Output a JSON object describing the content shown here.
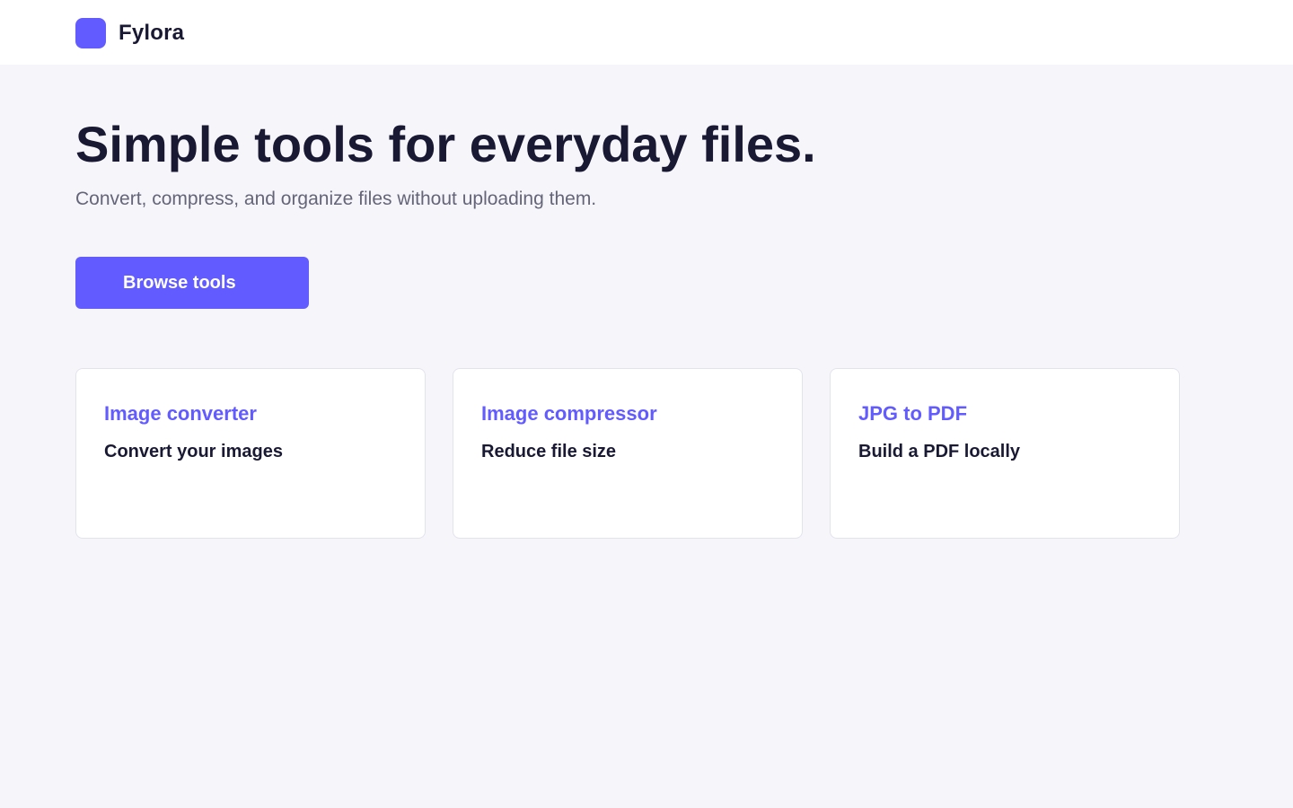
{
  "header": {
    "brand_name": "Fylora"
  },
  "hero": {
    "title": "Simple tools for everyday files.",
    "subtitle": "Convert, compress, and organize files without uploading them.",
    "cta_label": "Browse tools"
  },
  "tools": [
    {
      "title": "Image converter",
      "description": "Convert your images"
    },
    {
      "title": "Image compressor",
      "description": "Reduce file size"
    },
    {
      "title": "JPG to PDF",
      "description": "Build a PDF locally"
    }
  ],
  "colors": {
    "accent": "#625bff",
    "text": "#191934",
    "muted": "#656579",
    "page_background": "#f5f5fa",
    "surface": "#ffffff"
  }
}
